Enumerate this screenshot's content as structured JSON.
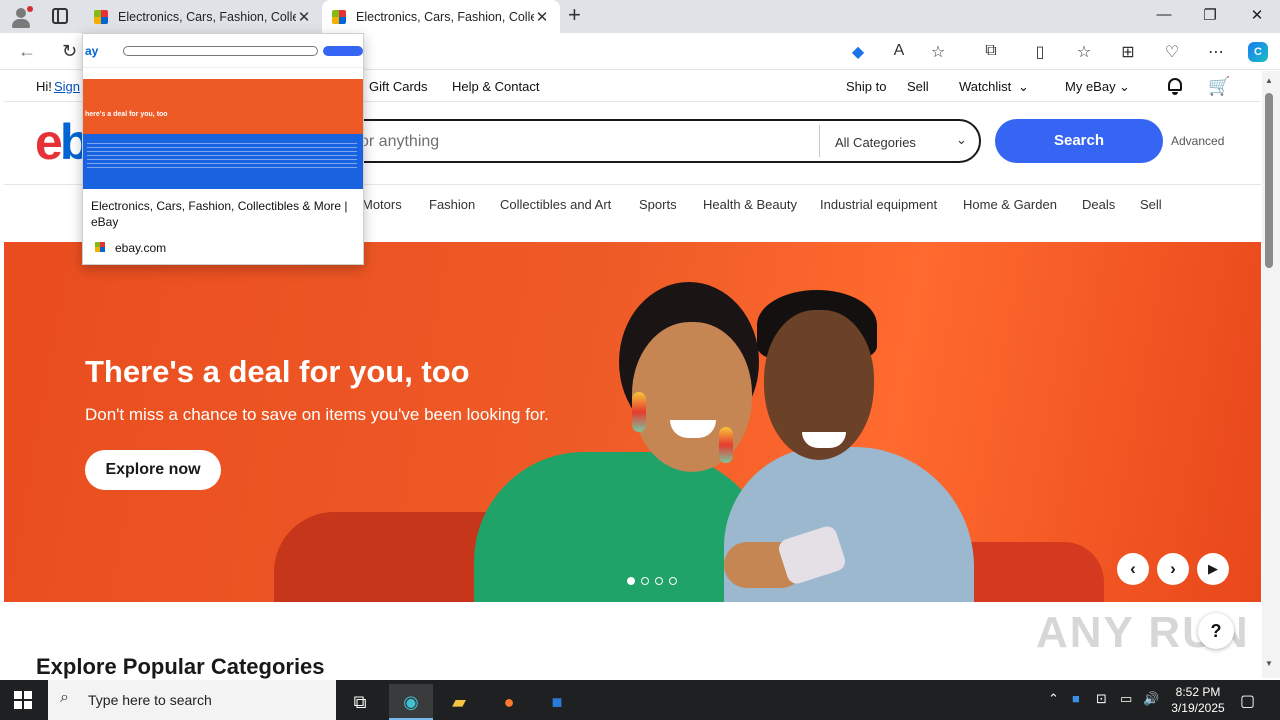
{
  "browser": {
    "tabs": [
      {
        "title": "Electronics, Cars, Fashion, Collecti",
        "state": "inactive"
      },
      {
        "title": "Electronics, Cars, Fashion, Collecti",
        "state": "active"
      }
    ],
    "new_tab_icon": "plus-icon",
    "window_controls": {
      "minimize": "—",
      "restore": "❐",
      "close": "✕"
    },
    "tab_preview": {
      "title": "Electronics, Cars, Fashion, Collectibles & More | eBay",
      "domain": "ebay.com",
      "mini_hero_text": "here's a deal for you, too"
    }
  },
  "ebay": {
    "util_bar": {
      "greeting": "Hi!",
      "sign_in": "Sign",
      "gift_cards": "Gift Cards",
      "help_contact": "Help & Contact",
      "ship_to": "Ship to",
      "sell": "Sell",
      "watchlist": "Watchlist",
      "my_ebay": "My eBay"
    },
    "search": {
      "placeholder": "or anything",
      "category": "All Categories",
      "button": "Search",
      "advanced": "Advanced"
    },
    "categories": [
      "Motors",
      "Fashion",
      "Collectibles and Art",
      "Sports",
      "Health & Beauty",
      "Industrial equipment",
      "Home & Garden",
      "Deals",
      "Sell"
    ],
    "hero": {
      "title": "There's a deal for you, too",
      "subtitle": "Don't miss a chance to save on items you've been looking for.",
      "cta": "Explore now",
      "slide_count": 4,
      "active_slide": 1
    },
    "section_title": "Explore Popular Categories",
    "help_label": "?"
  },
  "watermark": "ANY RUN",
  "taskbar": {
    "search_placeholder": "Type here to search",
    "time": "8:52 PM",
    "date": "3/19/2025"
  },
  "colors": {
    "ebay_red": "#e53238",
    "ebay_blue": "#0064d2",
    "search_button": "#3665f3",
    "hero_orange": "#ee5a26"
  }
}
